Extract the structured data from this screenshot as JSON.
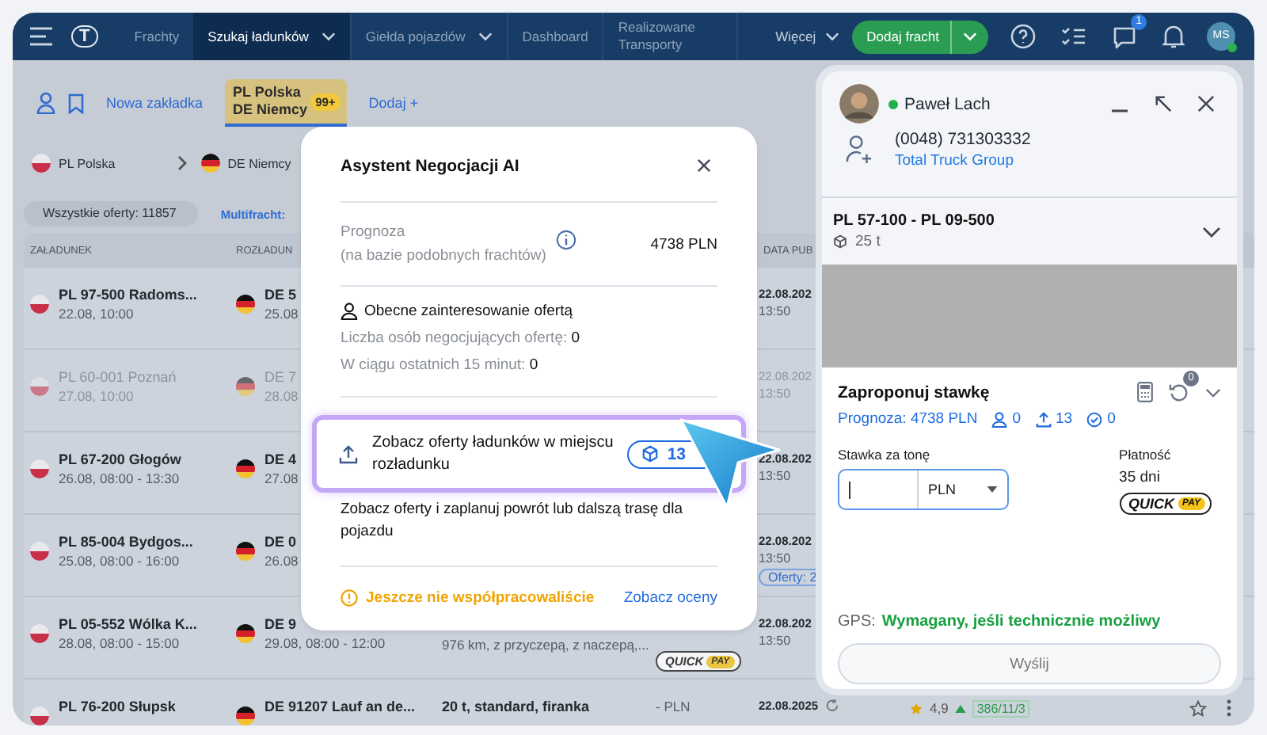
{
  "nav": {
    "logo": "T",
    "items": [
      {
        "label": "Frachty",
        "selected": false,
        "dropdown": false
      },
      {
        "label": "Szukaj ładunków",
        "selected": true,
        "dropdown": true
      },
      {
        "label": "Giełda pojazdów",
        "selected": false,
        "dropdown": true
      },
      {
        "label": "Dashboard",
        "selected": false,
        "dropdown": false
      },
      {
        "label": "Realizowane Transporty",
        "selected": false,
        "dropdown": false
      }
    ],
    "more": "Więcej",
    "add_button": "Dodaj fracht",
    "chat_badge": "1",
    "avatar": "MS"
  },
  "toolbar": {
    "new_tab": "Nowa zakładka",
    "tabs": [
      {
        "line1": "PL Polska",
        "line2": "DE Niemcy",
        "badge": "99+",
        "selected": true
      }
    ],
    "add_tab": "Dodaj +"
  },
  "route": {
    "from": "PL Polska",
    "to": "DE Niemcy"
  },
  "counts": {
    "all": "Wszystkie oferty: 11857",
    "multi": "Multifracht:"
  },
  "table": {
    "columns": [
      "ZAŁADUNEK",
      "ROZŁADUN",
      "DATA PUB"
    ],
    "rows": [
      {
        "dimmed": false,
        "from": "PL 97-500 Radoms...",
        "from_time": "22.08, 10:00",
        "to": "DE 5",
        "to_time": "25.08",
        "published": "22.08.202",
        "published_time": "13:50"
      },
      {
        "dimmed": true,
        "from": "PL 60-001 Poznań",
        "from_time": "27.08, 10:00",
        "to": "DE 7",
        "to_time": "28.08",
        "published": "22.08.202",
        "published_time": "13:50"
      },
      {
        "dimmed": false,
        "from": "PL 67-200 Głogów",
        "from_time": "26.08, 08:00 - 13:30",
        "to": "DE 4",
        "to_time": "27.08",
        "published": "22.08.202",
        "published_time": "13:50"
      },
      {
        "dimmed": false,
        "from": "PL 85-004 Bydgos...",
        "from_time": "25.08, 08:00 - 16:00",
        "to": "DE 0",
        "to_time": "26.08",
        "published": "22.08.202",
        "published_time": "13:50",
        "offers": "Oferty: 2"
      },
      {
        "dimmed": false,
        "from": "PL 05-552 Wólka K...",
        "from_time": "28.08, 08:00 - 15:00",
        "to": "DE 9",
        "to_time": "29.08, 08:00 - 12:00",
        "details": "976 km, z przyczepą, z naczepą,...",
        "quickpay": [
          "QUICK",
          "PAY"
        ],
        "published": "22.08.202",
        "published_time": "13:50"
      },
      {
        "dimmed": false,
        "from": "PL 76-200 Słupsk",
        "to": "DE 91207 Lauf an de...",
        "details": "20 t, standard, firanka",
        "price": "- PLN",
        "published": "22.08.2025",
        "rating": "4,9",
        "stats": "386/11/3"
      }
    ]
  },
  "modal": {
    "title": "Asystent Negocjacji AI",
    "forecast_label": "Prognoza",
    "forecast_note": "(na bazie podobnych frachtów)",
    "forecast_value": "4738 PLN",
    "interest_title": "Obecne zainteresowanie ofertą",
    "stats": [
      "Liczba osób negocjujących ofertę: **0**",
      "W ciągu ostatnich 15 minut: **0**"
    ],
    "unload_offers": {
      "label": "Zobacz oferty ładunków w miejscu rozładunku",
      "count": "13",
      "highlighted": true
    },
    "unload_note": "Zobacz oferty i zaplanuj powrót lub dalszą trasę dla pojazdu",
    "warning": "Jeszcze nie współpracowaliście",
    "ratings_link": "Zobacz oceny"
  },
  "panel": {
    "contact": {
      "name": "Paweł Lach",
      "online": true,
      "phone": "(0048) 731303332",
      "company": "Total Truck Group"
    },
    "route": "PL 57-100 - PL 09-500",
    "weight": "25 t",
    "offer": {
      "title": "Zaproponuj stawkę",
      "history_badge": "0",
      "forecast": "Prognoza: 4738 PLN",
      "negotiators": "0",
      "unload_offers": "13",
      "accepted": "0",
      "rate_label": "Stawka za tonę",
      "currency": "PLN",
      "payment_label": "Płatność",
      "payment_term": "35 dni",
      "quickpay": [
        "QUICK",
        "PAY"
      ]
    },
    "gps_label": "GPS:",
    "gps_value": "Wymagany, jeśli technicznie możliwy",
    "send": "Wyślij"
  }
}
